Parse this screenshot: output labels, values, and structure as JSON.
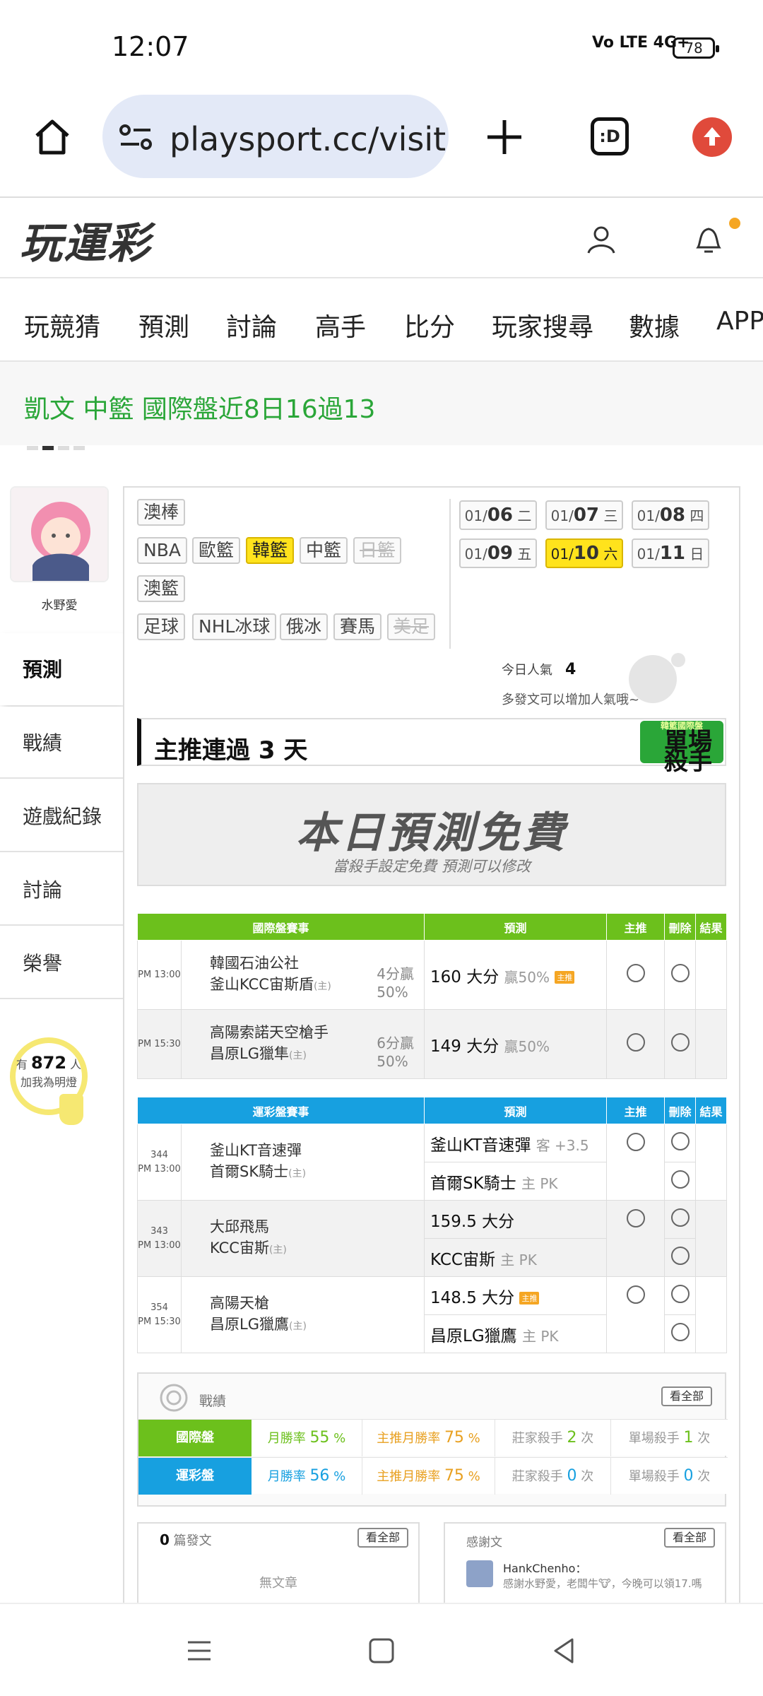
{
  "status": {
    "time": "12:07",
    "signal": "Vo LTE 4G+",
    "battery": "78"
  },
  "browser": {
    "url": "playsport.cc/visit",
    "tabs_label": ":D"
  },
  "site": {
    "logo": "玩運彩"
  },
  "nav": [
    "玩競猜",
    "預測",
    "討論",
    "高手",
    "比分",
    "玩家搜尋",
    "數據",
    "APP"
  ],
  "marquee": "凱文 中籃 國際盤近8日16過13",
  "profile": {
    "name": "水野愛"
  },
  "sidebar": [
    "預測",
    "戰績",
    "遊戲紀錄",
    "討論",
    "榮譽"
  ],
  "fans": {
    "prefix": "有",
    "count": "872",
    "suffix": "人",
    "action": "加我為明燈"
  },
  "leagues": {
    "row1": [
      "澳棒"
    ],
    "row2": [
      "NBA",
      "歐籃",
      "韓籃",
      "中籃",
      "日籃"
    ],
    "row3": [
      "澳籃"
    ],
    "row4": [
      "足球",
      "NHL冰球",
      "俄冰",
      "賽馬",
      "美足"
    ],
    "selected": "韓籃",
    "disabled": [
      "日籃",
      "美足"
    ]
  },
  "dates": [
    {
      "md": "01/",
      "d": "06",
      "w": "二"
    },
    {
      "md": "01/",
      "d": "07",
      "w": "三"
    },
    {
      "md": "01/",
      "d": "08",
      "w": "四"
    },
    {
      "md": "01/",
      "d": "09",
      "w": "五"
    },
    {
      "md": "01/",
      "d": "10",
      "w": "六"
    },
    {
      "md": "01/",
      "d": "11",
      "w": "日"
    }
  ],
  "popularity": {
    "label": "今日人氣",
    "value": "4",
    "hint": "多發文可以增加人氣哦~"
  },
  "streak": {
    "title": "主推連過 3 天",
    "badge": "單場殺手",
    "badge_sub": "韓籃國際盤"
  },
  "free_banner": {
    "title": "本日預測免費",
    "subtitle": "當殺手設定免費  預測可以修改"
  },
  "intl_table": {
    "headers": [
      "國際盤賽事",
      "預測",
      "主推",
      "刪除",
      "結果"
    ],
    "rows": [
      {
        "time": "PM 13:00",
        "away": "韓國石油公社",
        "home": "釜山KCC宙斯盾",
        "home_mark": "(主)",
        "line": "4分贏",
        "line2": "50%",
        "pred": "160 大分",
        "pred_note": "贏50%",
        "hot": "主推"
      },
      {
        "time": "PM 15:30",
        "away": "高陽索諾天空槍手",
        "home": "昌原LG獵隼",
        "home_mark": "(主)",
        "line": "6分贏",
        "line2": "50%",
        "pred": "149 大分",
        "pred_note": "贏50%",
        "hot": ""
      }
    ]
  },
  "lottery_table": {
    "headers": [
      "運彩盤賽事",
      "預測",
      "主推",
      "刪除",
      "結果"
    ],
    "games": [
      {
        "no": "344",
        "time": "PM 13:00",
        "away": "釜山KT音速彈",
        "home": "首爾SK騎士",
        "home_mark": "(主)",
        "pred1": "釜山KT音速彈",
        "pred1_note": "客 +3.5",
        "pred2": "首爾SK騎士",
        "pred2_note": "主 PK",
        "hot": ""
      },
      {
        "no": "343",
        "time": "PM 13:00",
        "away": "大邱飛馬",
        "home": "KCC宙斯",
        "home_mark": "(主)",
        "pred1": "159.5 大分",
        "pred1_note": "",
        "pred2": "KCC宙斯",
        "pred2_note": "主 PK",
        "hot": ""
      },
      {
        "no": "354",
        "time": "PM 15:30",
        "away": "高陽天槍",
        "home": "昌原LG獵鷹",
        "home_mark": "(主)",
        "pred1": "148.5 大分",
        "pred1_note": "",
        "pred2": "昌原LG獵鷹",
        "pred2_note": "主 PK",
        "hot": "主推"
      }
    ]
  },
  "record": {
    "title": "戰績",
    "view_all": "看全部",
    "rows": [
      {
        "label": "國際盤",
        "color": "#6cc01c",
        "win_label": "月勝率",
        "win": "55",
        "main_label": "主推月勝率",
        "main": "75",
        "dealer_label": "莊家殺手",
        "dealer": "2",
        "single_label": "單場殺手",
        "single": "1",
        "unit": "次",
        "pct": "%"
      },
      {
        "label": "運彩盤",
        "color": "#17a0e0",
        "win_label": "月勝率",
        "win": "56",
        "main_label": "主推月勝率",
        "main": "75",
        "dealer_label": "莊家殺手",
        "dealer": "0",
        "single_label": "單場殺手",
        "single": "0",
        "unit": "次",
        "pct": "%"
      }
    ]
  },
  "posts": {
    "count": "0",
    "label": "篇發文",
    "view_all": "看全部",
    "empty": "無文章"
  },
  "thanks": {
    "title": "感謝文",
    "view_all": "看全部",
    "user": "HankChenho：",
    "text": "感謝水野愛，老闆牛🐮，今晚可以領17.嗎"
  }
}
